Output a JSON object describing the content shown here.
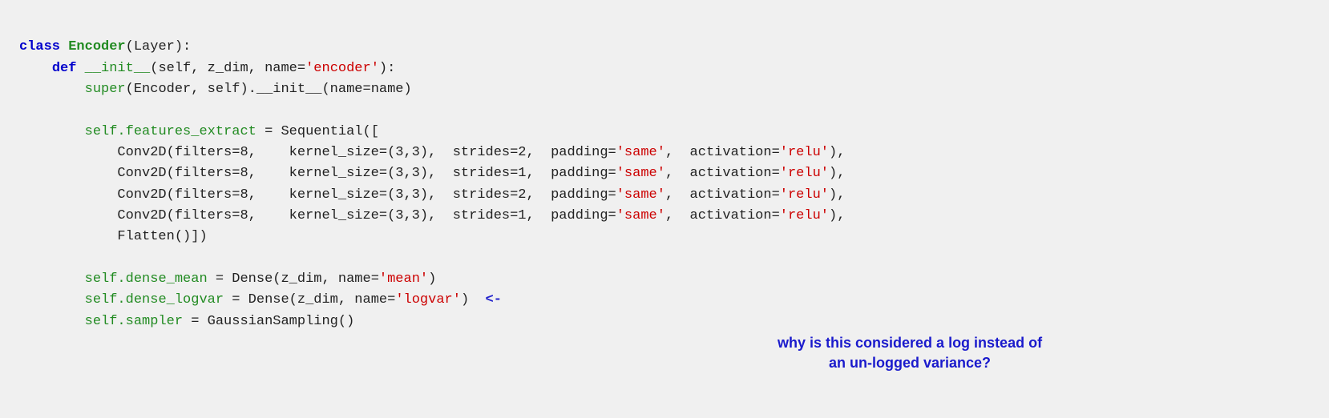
{
  "code": {
    "line1": {
      "kw_class": "class",
      "name": "Encoder",
      "rest": "(Layer):"
    },
    "line2": {
      "kw_def": "def",
      "fn": "__init__",
      "params_before": "(self, z_dim, name=",
      "str_encoder": "'encoder'",
      "params_after": "):"
    },
    "line3": {
      "fn_super": "super",
      "rest": "(Encoder, self).__init__(name=name)"
    },
    "line5": {
      "obj": "self.features_extract",
      "rest": " = Sequential(["
    },
    "line6": {
      "fn": "Conv2D",
      "p1": "(filters=8,",
      "p2": "kernel_size=(3,3),",
      "p3": "strides=2,",
      "p4a": "padding=",
      "str1": "'same'",
      "p4b": ",",
      "p5a": "activation=",
      "str2": "'relu'",
      "p5b": "),"
    },
    "line7": {
      "fn": "Conv2D",
      "p1": "(filters=8,",
      "p2": "kernel_size=(3,3),",
      "p3": "strides=1,",
      "p4a": "padding=",
      "str1": "'same'",
      "p4b": ",",
      "p5a": "activation=",
      "str2": "'relu'",
      "p5b": "),"
    },
    "line8": {
      "fn": "Conv2D",
      "p1": "(filters=8,",
      "p2": "kernel_size=(3,3),",
      "p3": "strides=2,",
      "p4a": "padding=",
      "str1": "'same'",
      "p4b": ",",
      "p5a": "activation=",
      "str2": "'relu'",
      "p5b": "),"
    },
    "line9": {
      "fn": "Conv2D",
      "p1": "(filters=8,",
      "p2": "kernel_size=(3,3),",
      "p3": "strides=1,",
      "p4a": "padding=",
      "str1": "'same'",
      "p4b": ",",
      "p5a": "activation=",
      "str2": "'relu'",
      "p5b": "),"
    },
    "line10": {
      "fn": "Flatten",
      "rest": "()])"
    },
    "line12": {
      "obj": "self.dense_mean",
      "rest1": " = Dense(z_dim, name=",
      "str1": "'mean'",
      "rest2": ")"
    },
    "line13": {
      "obj": "self.dense_logvar",
      "rest1": " = Dense(z_dim, name=",
      "str1": "'logvar'",
      "rest2": ")"
    },
    "line14": {
      "obj": "self.sampler",
      "rest": " = GaussianSampling()"
    }
  },
  "annotation": {
    "line1": "why is this considered a log instead of",
    "line2": "an un-logged variance?"
  }
}
